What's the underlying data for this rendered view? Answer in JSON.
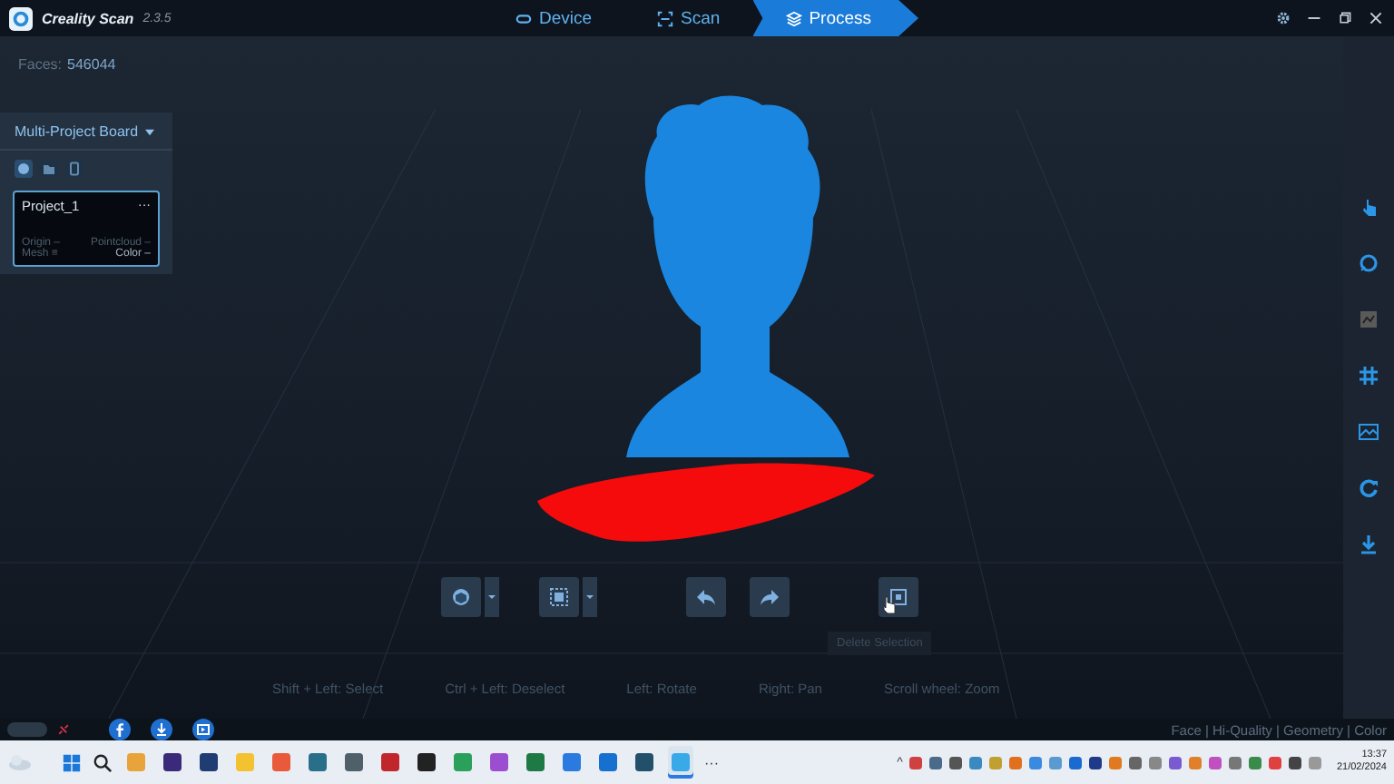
{
  "window": {
    "title": "Creality Scan",
    "version": "2.3.5"
  },
  "mode_tabs": [
    {
      "label": "Device",
      "selected": false
    },
    {
      "label": "Scan",
      "selected": false
    },
    {
      "label": "Process",
      "selected": true
    }
  ],
  "faces": {
    "label": "Faces:",
    "value": "546044"
  },
  "project_board": {
    "title": "Multi-Project Board",
    "tabs": [
      {
        "selected": true
      },
      {
        "selected": false
      },
      {
        "selected": false
      }
    ],
    "project": {
      "name": "Project_1",
      "menu": "···",
      "origin": "Origin –",
      "pointcloud": "Pointcloud –",
      "mesh": "Mesh ≡",
      "color_status": "Color –"
    }
  },
  "toolbar": [
    {
      "kind": "dropdown"
    },
    {
      "kind": "dropdown"
    },
    {
      "kind": "plain"
    },
    {
      "kind": "plain"
    },
    {
      "kind": "plain"
    }
  ],
  "tooltip": "Delete Selection",
  "hints": [
    "Shift + Left:  Select",
    "Ctrl + Left:  Deselect",
    "Left:  Rotate",
    "Right:  Pan",
    "Scroll wheel:  Zoom"
  ],
  "right_tools": [
    {
      "disabled": false
    },
    {
      "disabled": false
    },
    {
      "disabled": true
    },
    {
      "disabled": false
    },
    {
      "disabled": false
    },
    {
      "disabled": false
    },
    {
      "disabled": false
    }
  ],
  "status_modes": "Face | Hi-Quality | Geometry | Color",
  "taskbar": {
    "apps": [
      {
        "color": "#e8a33a",
        "selected": false
      },
      {
        "color": "#3b2a7a",
        "selected": false
      },
      {
        "color": "#1f3d73",
        "selected": false
      },
      {
        "color": "#f2c230",
        "selected": false
      },
      {
        "color": "#e85a3a",
        "selected": false
      },
      {
        "color": "#2a6f8a",
        "selected": false
      },
      {
        "color": "#50606a",
        "selected": false
      },
      {
        "color": "#c0262b",
        "selected": false
      },
      {
        "color": "#222222",
        "selected": false
      },
      {
        "color": "#2aa05a",
        "selected": false
      },
      {
        "color": "#9b4fd0",
        "selected": false
      },
      {
        "color": "#1e7a45",
        "selected": false
      },
      {
        "color": "#2a7ae0",
        "selected": false
      },
      {
        "color": "#1670d0",
        "selected": false
      },
      {
        "color": "#22506a",
        "selected": false
      },
      {
        "color": "#3aa9e8",
        "selected": true
      }
    ],
    "more": "···",
    "tray_arrow": "^",
    "tray": [
      {
        "color": "#d04040"
      },
      {
        "color": "#4a6a8a"
      },
      {
        "color": "#555555"
      },
      {
        "color": "#3a8ac0"
      },
      {
        "color": "#c0a030"
      },
      {
        "color": "#e07020"
      },
      {
        "color": "#3a8ae0"
      },
      {
        "color": "#5a9ad0"
      },
      {
        "color": "#1a6ad0"
      },
      {
        "color": "#203a8a"
      },
      {
        "color": "#e07a20"
      },
      {
        "color": "#666666"
      },
      {
        "color": "#888888"
      },
      {
        "color": "#7a5ad0"
      },
      {
        "color": "#e0802a"
      },
      {
        "color": "#c050c0"
      },
      {
        "color": "#777777"
      },
      {
        "color": "#3a8a4a"
      },
      {
        "color": "#e04040"
      },
      {
        "color": "#444444"
      },
      {
        "color": "#999999"
      }
    ],
    "time": "13:37",
    "date": "21/02/2024"
  }
}
